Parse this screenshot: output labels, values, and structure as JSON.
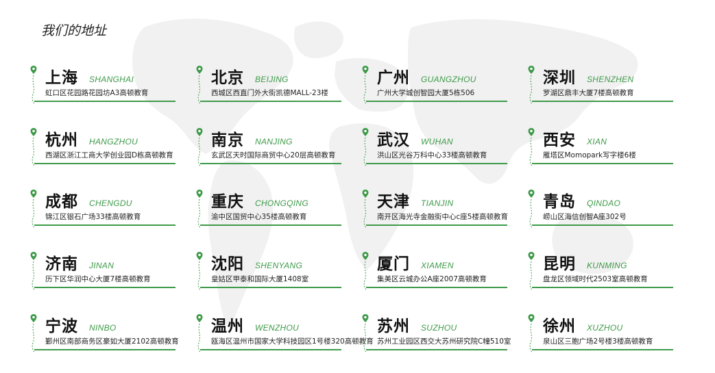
{
  "page_title": "我们的地址",
  "colors": {
    "accent": "#3d9a48",
    "text": "#111111",
    "map": "#efefef"
  },
  "icon": "location-pin-icon",
  "offices": [
    {
      "city": "上海",
      "pinyin": "SHANGHAI",
      "address": "虹口区花园路花园坊A3高顿教育"
    },
    {
      "city": "北京",
      "pinyin": "BEIJING",
      "address": "西城区西直门外大街凯德MALL-23楼"
    },
    {
      "city": "广州",
      "pinyin": "GUANGZHOU",
      "address": "广州大学城创智园大厦5栋506"
    },
    {
      "city": "深圳",
      "pinyin": "SHENZHEN",
      "address": "罗湖区鼎丰大厦7楼高顿教育"
    },
    {
      "city": "杭州",
      "pinyin": "HANGZHOU",
      "address": "西湖区浙江工商大学创业园D栋高顿教育"
    },
    {
      "city": "南京",
      "pinyin": "NANJING",
      "address": "玄武区天时国际商贸中心20层高顿教育"
    },
    {
      "city": "武汉",
      "pinyin": "WUHAN",
      "address": "洪山区光谷万科中心33楼高顿教育"
    },
    {
      "city": "西安",
      "pinyin": "XIAN",
      "address": "雁塔区Momopark写字楼6楼"
    },
    {
      "city": "成都",
      "pinyin": "CHENGDU",
      "address": "锦江区银石广场33楼高顿教育"
    },
    {
      "city": "重庆",
      "pinyin": "CHONGQING",
      "address": "渝中区国贸中心35楼高顿教育"
    },
    {
      "city": "天津",
      "pinyin": "TIANJIN",
      "address": "南开区海光寺金融街中心c座5楼高顿教育"
    },
    {
      "city": "青岛",
      "pinyin": "QINDAO",
      "address": "崂山区海信创智A座302号"
    },
    {
      "city": "济南",
      "pinyin": "JINAN",
      "address": "历下区华润中心大厦7楼高顿教育"
    },
    {
      "city": "沈阳",
      "pinyin": "SHENYANG",
      "address": "皇姑区甲泰和国际大厦1408室"
    },
    {
      "city": "厦门",
      "pinyin": "XIAMEN",
      "address": "集美区云城办公A座2007高顿教育"
    },
    {
      "city": "昆明",
      "pinyin": "KUNMING",
      "address": "盘龙区领域时代2503室高顿教育"
    },
    {
      "city": "宁波",
      "pinyin": "NINBO",
      "address": "鄞州区南部商务区豪如大厦2102高顿教育"
    },
    {
      "city": "温州",
      "pinyin": "WENZHOU",
      "address": "瓯海区温州市国家大学科技园区1号楼320高顿教育"
    },
    {
      "city": "苏州",
      "pinyin": "SUZHOU",
      "address": "苏州工业园区西交大苏州研究院C幢510室"
    },
    {
      "city": "徐州",
      "pinyin": "XUZHOU",
      "address": "泉山区三胞广场2号楼3楼高顿教育"
    }
  ]
}
